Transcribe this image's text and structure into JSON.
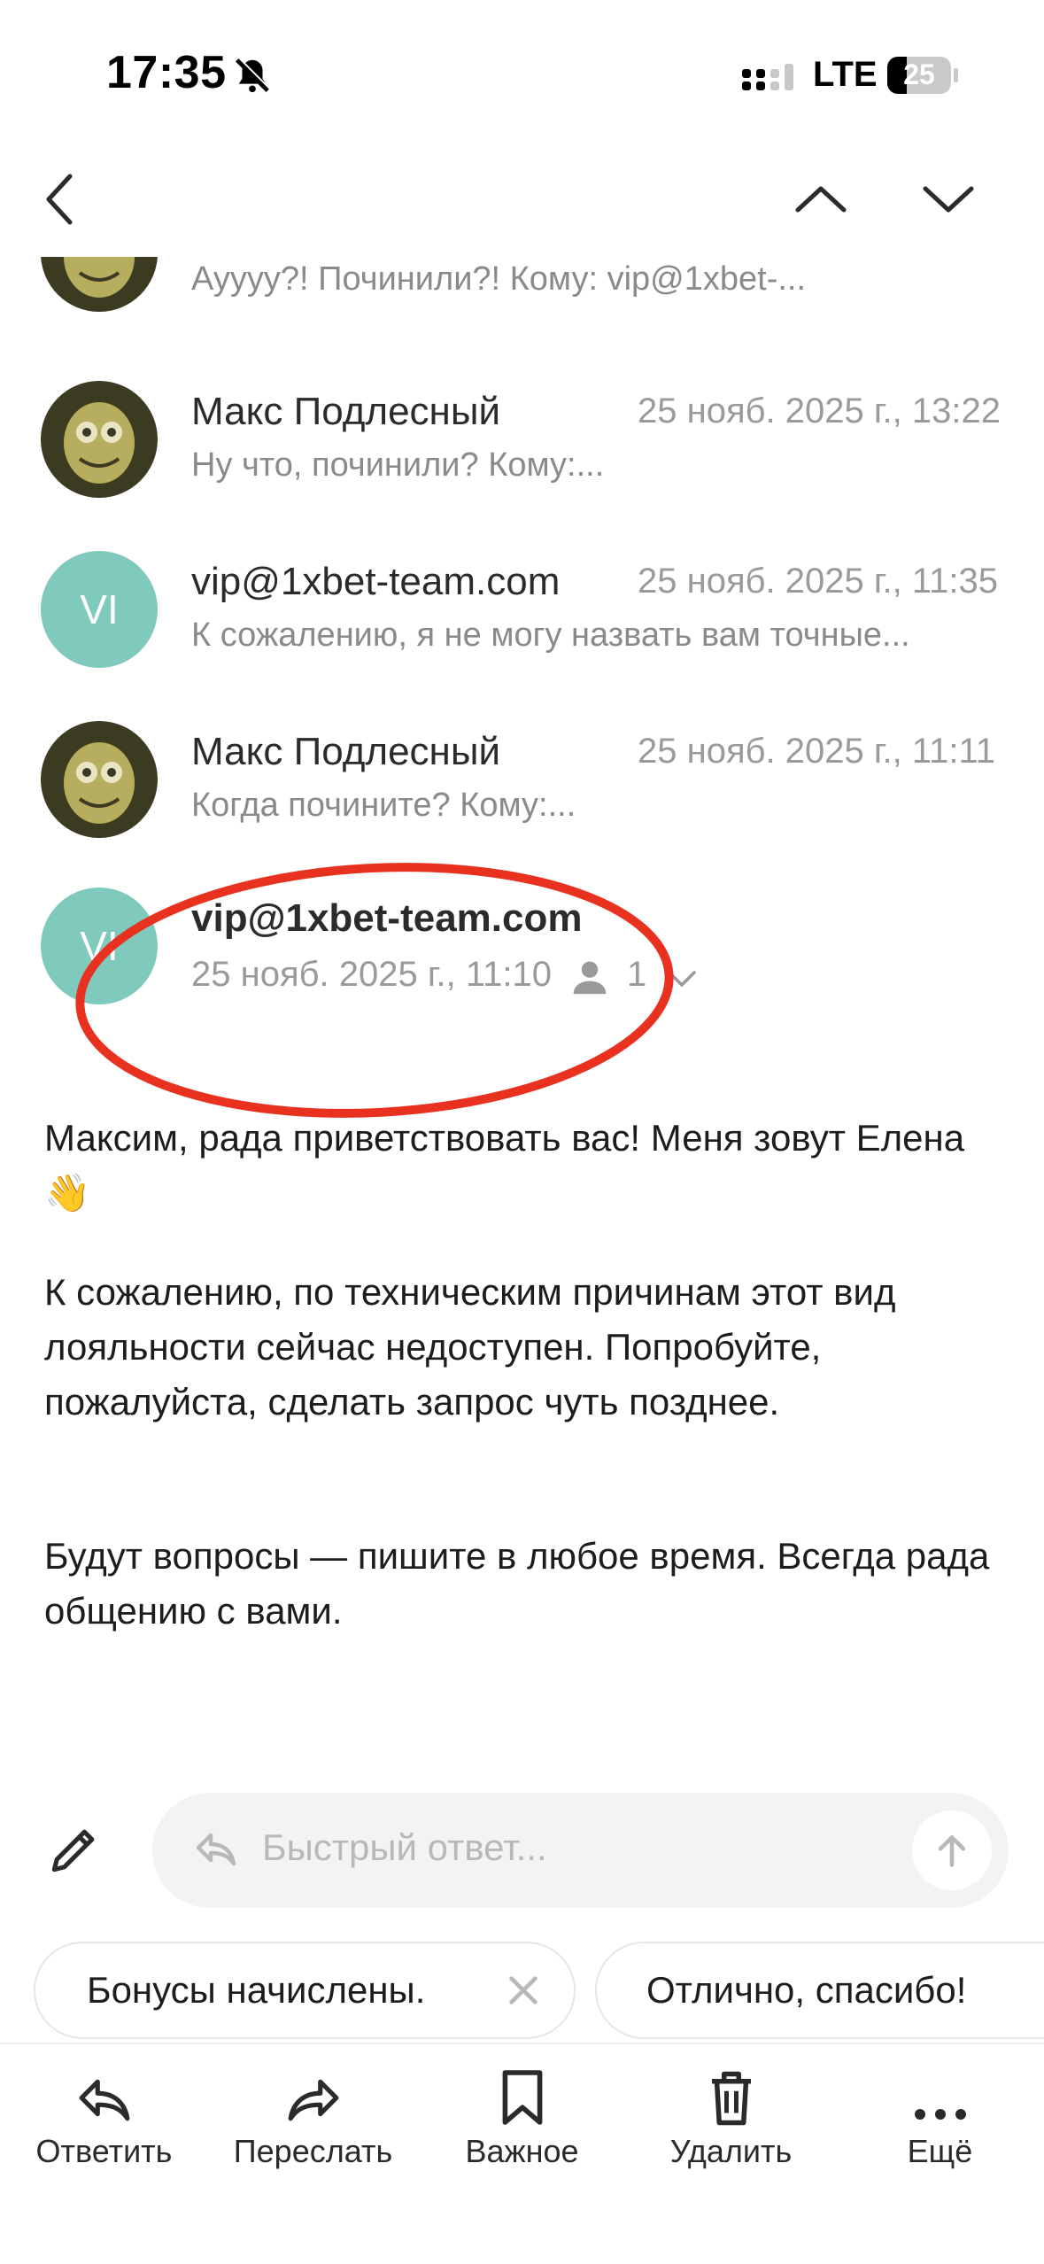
{
  "status_bar": {
    "time": "17:35",
    "network": "LTE",
    "battery": "25"
  },
  "thread": [
    {
      "sender": "",
      "date": "",
      "snippet": "Ауууу?! Починили?! Кому: vip@1xbet-...",
      "avatar": "spongebob"
    },
    {
      "sender": "Макс Подлесный",
      "date": "25 нояб. 2025 г., 13:22",
      "snippet": "Ну что, починили? Кому:...",
      "avatar": "spongebob"
    },
    {
      "sender": "vip@1xbet-team.com",
      "date": "25 нояб. 2025 г., 11:35",
      "snippet": "К сожалению, я не могу назвать вам точные...",
      "avatar": "VI"
    },
    {
      "sender": "Макс Подлесный",
      "date": "25 нояб. 2025 г., 11:11",
      "snippet": "Когда почините? Кому:...",
      "avatar": "spongebob"
    }
  ],
  "open_message": {
    "avatar": "VI",
    "sender": "vip@1xbet-team.com",
    "date": "25 нояб. 2025 г., 11:10",
    "recipients_count": "1",
    "paragraphs": [
      "Максим, рада приветствовать вас! Меня зовут Елена 👋",
      "К сожалению, по техническим причинам этот вид лояльности сейчас недоступен. Попробуйте, пожалуйста, сделать запрос чуть позднее.",
      "Будут вопросы — пишите в любое время. Всегда рада общению с вами."
    ]
  },
  "reply": {
    "placeholder": "Быстрый ответ..."
  },
  "suggestions": [
    "Бонусы начислены.",
    "Отлично, спасибо!"
  ],
  "toolbar": {
    "reply": "Ответить",
    "forward": "Переслать",
    "important": "Важное",
    "delete": "Удалить",
    "more": "Ещё"
  },
  "colors": {
    "avatar_vi": "#7fc9bd",
    "annotation": "#e8321f"
  }
}
